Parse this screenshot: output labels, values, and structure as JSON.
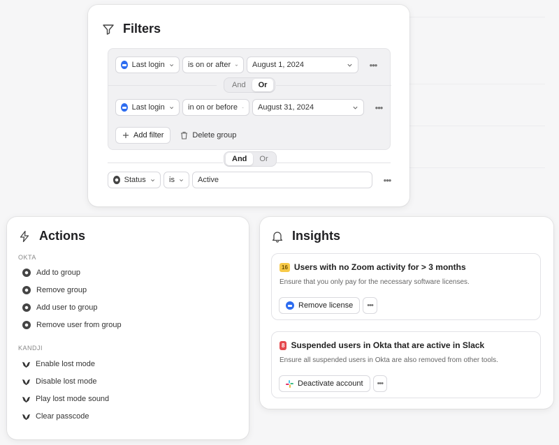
{
  "filters": {
    "title": "Filters",
    "rows": [
      {
        "field": "Last login",
        "operator": "is on or after",
        "value": "August 1, 2024"
      },
      {
        "field": "Last login",
        "operator": "in on or before",
        "value": "August 31, 2024"
      }
    ],
    "inner_toggle": {
      "and": "And",
      "or": "Or",
      "active": "or"
    },
    "add_filter": "Add filter",
    "delete_group": "Delete group",
    "outer_toggle": {
      "and": "And",
      "or": "Or",
      "active": "and"
    },
    "status_row": {
      "field": "Status",
      "operator": "is",
      "value": "Active"
    },
    "more": "•••"
  },
  "actions": {
    "title": "Actions",
    "sections": [
      {
        "label": "OKTA",
        "items": [
          "Add to group",
          "Remove group",
          "Add user to group",
          "Remove user from group"
        ]
      },
      {
        "label": "KANDJI",
        "items": [
          "Enable lost mode",
          "Disable lost mode",
          "Play lost mode sound",
          "Clear passcode"
        ]
      }
    ]
  },
  "insights": {
    "title": "Insights",
    "cards": [
      {
        "badge": "16",
        "badge_color": "#f7c948",
        "title": "Users with no Zoom activity for > 3 months",
        "desc": "Ensure that you only pay for the necessary software licenses.",
        "action": "Remove license",
        "action_icon": "zoom-icon"
      },
      {
        "badge": "8",
        "badge_color": "#e5484d",
        "title": "Suspended users in Okta that are active in Slack",
        "desc": "Ensure all suspended users in Okta are also removed from other tools.",
        "action": "Deactivate account",
        "action_icon": "slack-icon"
      }
    ],
    "more": "•••"
  },
  "colors": {
    "zoom": "#2d6cf0",
    "accent_text": "#1f1f22"
  }
}
